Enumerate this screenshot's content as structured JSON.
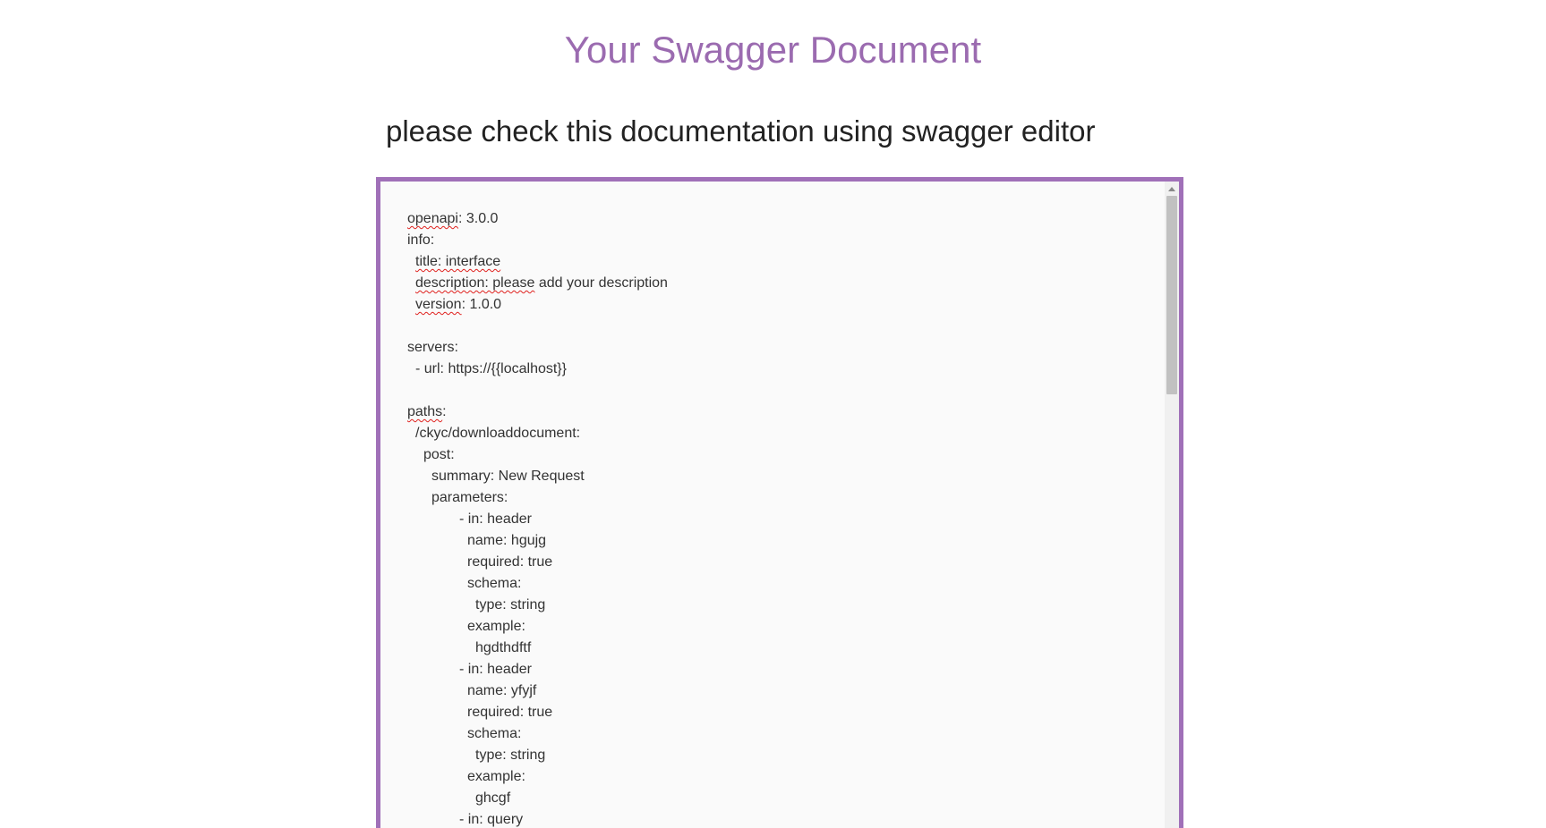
{
  "header": {
    "title": "Your Swagger Document",
    "subtitle": "please check this documentation using swagger editor"
  },
  "colors": {
    "title": "#9b6bb0",
    "editor_border": "#a070b8",
    "spellcheck": "#e0221f"
  },
  "editor": {
    "lines": [
      {
        "indent": 0,
        "marked": "openapi",
        "rest": ": 3.0.0"
      },
      {
        "indent": 0,
        "marked": "",
        "rest": "info:"
      },
      {
        "indent": 1,
        "marked": "title: interface",
        "rest": ""
      },
      {
        "indent": 1,
        "marked": "description: please",
        "rest": " add your description"
      },
      {
        "indent": 1,
        "marked": "version",
        "rest": ": 1.0.0"
      },
      {
        "indent": 0,
        "marked": "",
        "rest": ""
      },
      {
        "indent": 0,
        "marked": "",
        "rest": "servers:"
      },
      {
        "indent": 1,
        "marked": "",
        "rest": "- url: https://{{localhost}}"
      },
      {
        "indent": 0,
        "marked": "",
        "rest": ""
      },
      {
        "indent": 0,
        "marked": "paths",
        "rest": ":"
      },
      {
        "indent": 1,
        "marked": "",
        "rest": "/ckyc/downloaddocument:"
      },
      {
        "indent": 2,
        "marked": "",
        "rest": "post:"
      },
      {
        "indent": 3,
        "marked": "",
        "rest": "summary: New Request"
      },
      {
        "indent": 3,
        "marked": "",
        "rest": "parameters:"
      },
      {
        "indent": 4,
        "marked": "",
        "rest": "- in: header"
      },
      {
        "indent": 5,
        "marked": "",
        "rest": "name: hgujg"
      },
      {
        "indent": 5,
        "marked": "",
        "rest": "required: true"
      },
      {
        "indent": 5,
        "marked": "",
        "rest": "schema:"
      },
      {
        "indent": 6,
        "marked": "",
        "rest": "type: string"
      },
      {
        "indent": 5,
        "marked": "",
        "rest": "example:"
      },
      {
        "indent": 6,
        "marked": "",
        "rest": "hgdthdftf"
      },
      {
        "indent": 4,
        "marked": "",
        "rest": "- in: header"
      },
      {
        "indent": 5,
        "marked": "",
        "rest": "name: yfyjf"
      },
      {
        "indent": 5,
        "marked": "",
        "rest": "required: true"
      },
      {
        "indent": 5,
        "marked": "",
        "rest": "schema:"
      },
      {
        "indent": 6,
        "marked": "",
        "rest": "type: string"
      },
      {
        "indent": 5,
        "marked": "",
        "rest": "example:"
      },
      {
        "indent": 6,
        "marked": "",
        "rest": "ghcgf"
      },
      {
        "indent": 4,
        "marked": "",
        "rest": "- in: query"
      }
    ]
  }
}
